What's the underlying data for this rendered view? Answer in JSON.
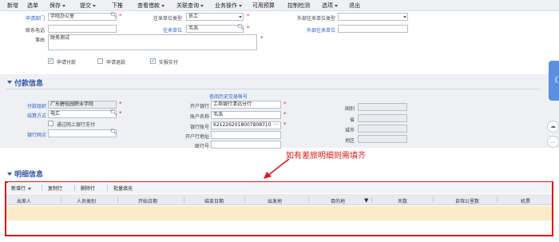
{
  "menu": [
    {
      "label": "新增",
      "dropdown": false
    },
    {
      "label": "选单",
      "dropdown": false
    },
    {
      "label": "保存",
      "dropdown": true
    },
    {
      "label": "提交",
      "dropdown": true
    },
    {
      "label": "下推",
      "dropdown": false
    },
    {
      "label": "查看借款",
      "dropdown": true
    },
    {
      "label": "关联查询",
      "dropdown": true
    },
    {
      "label": "业务操作",
      "dropdown": true
    },
    {
      "label": "可用预算",
      "dropdown": false
    },
    {
      "label": "控制检测",
      "dropdown": false
    },
    {
      "label": "选项",
      "dropdown": true
    },
    {
      "label": "退出",
      "dropdown": false
    }
  ],
  "form": {
    "apply_dept_label": "申请部门",
    "apply_dept_value": "学院办公室",
    "contact_label": "往来单位类型",
    "contact_type_value": "员工",
    "external_type_label": "外部往来单位类型",
    "phone_label": "联系电话",
    "partner_label": "往来单位",
    "partner_value": "韦浩",
    "external_partner_label": "外部往来单位",
    "reason_label": "事由",
    "reason_value": "财务测试",
    "chk_apply_pay": "申请付款",
    "chk_apply_refund": "申请退款",
    "chk_actual_report": "实报实付"
  },
  "payment": {
    "section_title": "付款信息",
    "history_link": "查阅历史交易帐号",
    "org_label": "付款组织",
    "org_value": "广东碧桂园职业学院",
    "method_label": "结算方式",
    "method_value": "电汇",
    "online_pay": "通过网上银行支付",
    "bank_branch_label": "银行网点",
    "open_bank_label": "开户银行",
    "open_bank_value": "工商银行清远分行",
    "account_name_label": "账户名称",
    "account_name_value": "韦浩",
    "account_no_label": "银行账号",
    "account_no_value": "6212262018007808710",
    "open_addr_label": "开户行地址",
    "bank_no_label": "联行号",
    "country_label": "国别",
    "province_label": "省",
    "city_label": "城市",
    "district_label": "地区"
  },
  "annotation": "如有差旅明细则需填齐",
  "detail": {
    "section_title": "明细信息",
    "toolbar": [
      {
        "label": "新增行",
        "dropdown": true
      },
      {
        "label": "复制行",
        "dropdown": false
      },
      {
        "label": "删除行",
        "dropdown": false
      },
      {
        "label": "批量填充",
        "dropdown": false
      }
    ],
    "columns": [
      "出差人",
      "人员类别",
      "开始日期",
      "结束日期",
      "出发地",
      "目的地",
      "天数",
      "自驾公里数",
      "机票"
    ]
  },
  "side": {
    "collapse_glyph": "《",
    "cloud_glyph": "☁",
    "chat_glyph": "…"
  }
}
